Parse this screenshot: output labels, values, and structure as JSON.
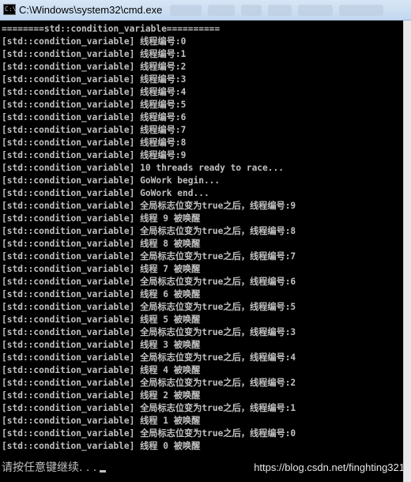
{
  "window": {
    "title": "C:\\Windows\\system32\\cmd.exe",
    "icon_text": "C:\\"
  },
  "console": {
    "lines": [
      "========std::condition_variable==========",
      "[std::condition_variable] 线程编号:0",
      "[std::condition_variable] 线程编号:1",
      "[std::condition_variable] 线程编号:2",
      "[std::condition_variable] 线程编号:3",
      "[std::condition_variable] 线程编号:4",
      "[std::condition_variable] 线程编号:5",
      "[std::condition_variable] 线程编号:6",
      "[std::condition_variable] 线程编号:7",
      "[std::condition_variable] 线程编号:8",
      "[std::condition_variable] 线程编号:9",
      "[std::condition_variable] 10 threads ready to race...",
      "[std::condition_variable] GoWork begin...",
      "[std::condition_variable] GoWork end...",
      "[std::condition_variable] 全局标志位变为true之后，线程编号:9",
      "[std::condition_variable] 线程 9 被唤醒",
      "[std::condition_variable] 全局标志位变为true之后，线程编号:8",
      "[std::condition_variable] 线程 8 被唤醒",
      "[std::condition_variable] 全局标志位变为true之后，线程编号:7",
      "[std::condition_variable] 线程 7 被唤醒",
      "[std::condition_variable] 全局标志位变为true之后，线程编号:6",
      "[std::condition_variable] 线程 6 被唤醒",
      "[std::condition_variable] 全局标志位变为true之后，线程编号:5",
      "[std::condition_variable] 线程 5 被唤醒",
      "[std::condition_variable] 全局标志位变为true之后，线程编号:3",
      "[std::condition_variable] 线程 3 被唤醒",
      "[std::condition_variable] 全局标志位变为true之后，线程编号:4",
      "[std::condition_variable] 线程 4 被唤醒",
      "[std::condition_variable] 全局标志位变为true之后，线程编号:2",
      "[std::condition_variable] 线程 2 被唤醒",
      "[std::condition_variable] 全局标志位变为true之后，线程编号:1",
      "[std::condition_variable] 线程 1 被唤醒",
      "[std::condition_variable] 全局标志位变为true之后，线程编号:0",
      "[std::condition_variable] 线程 0 被唤醒"
    ],
    "prompt": "请按任意键继续. . ."
  },
  "watermark": "https://blog.csdn.net/finghting321",
  "colors": {
    "console_bg": "#000000",
    "console_text": "#c0c0c0",
    "titlebar": "#d7e6f6"
  }
}
